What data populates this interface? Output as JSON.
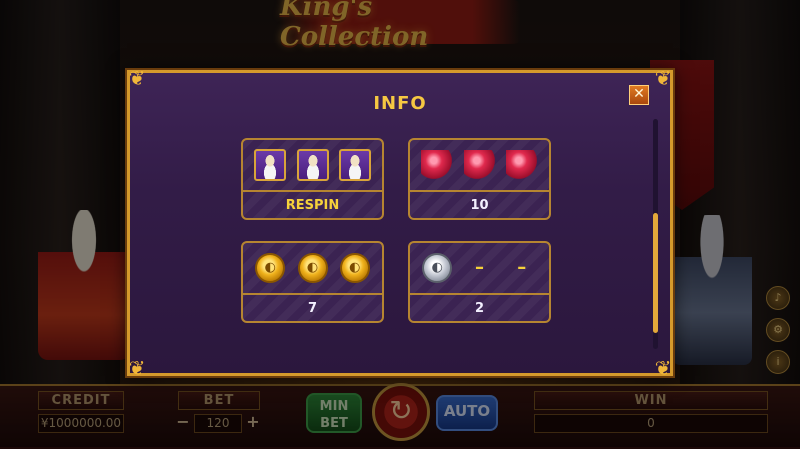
{
  "game": {
    "logo": "King's Collection"
  },
  "bottom_bar": {
    "credit_label": "CREDIT",
    "credit_value": "¥1000000.00",
    "bet_label": "BET",
    "bet_value": "120",
    "minus": "−",
    "plus": "+",
    "min_bet_line1": "MIN",
    "min_bet_line2": "BET",
    "spin_icon": "↻",
    "auto_label": "AUTO",
    "win_label": "WIN",
    "win_value": "0"
  },
  "dialog": {
    "title": "INFO",
    "close_symbol": "✕",
    "cards": [
      {
        "icon": "king-symbol-icon",
        "count": 3,
        "label": "RESPIN"
      },
      {
        "icon": "ruby-gem-icon",
        "count": 3,
        "label": "10"
      },
      {
        "icon": "gold-coin-icon",
        "count": 3,
        "label": "7"
      },
      {
        "icon": "silver-coin-icon",
        "count": 1,
        "dashes": [
          "–",
          "–"
        ],
        "label": "2"
      }
    ]
  },
  "colors": {
    "dialog_border": "#d59a2c",
    "title": "#f6c842",
    "respin_label": "#f6d23a"
  }
}
